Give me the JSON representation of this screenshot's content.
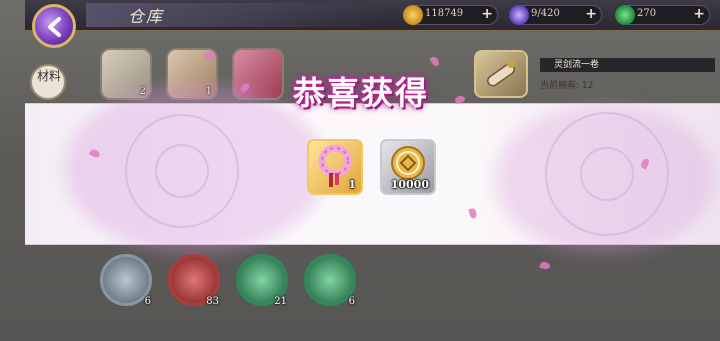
{
  "header": {
    "title": "仓库",
    "resources": [
      {
        "name": "gold",
        "icon": "gold-coin-icon",
        "value": "118749",
        "color": "#e0a83a"
      },
      {
        "name": "spirit",
        "icon": "purple-orb-icon",
        "value": "9/420",
        "color": "#7d5ad6"
      },
      {
        "name": "jade",
        "icon": "green-jade-icon",
        "value": "270",
        "color": "#37b24d"
      }
    ],
    "plus_label": "+"
  },
  "side_tabs": {
    "materials": "材料"
  },
  "inventory": {
    "top_row_counts": [
      "2",
      "1",
      "",
      ""
    ],
    "bottom_row": [
      {
        "icon": "wolf-blue-icon",
        "count": "6",
        "color": "#7d8fa0"
      },
      {
        "icon": "wolf-red-icon",
        "count": "83",
        "color": "#b13b3b"
      },
      {
        "icon": "wolf-green-icon",
        "count": "21",
        "color": "#2f8a5a"
      },
      {
        "icon": "wolf-green-icon",
        "count": "6",
        "color": "#2f8a5a"
      }
    ]
  },
  "detail": {
    "item_name": "灵剑流一卷",
    "owned_text": "当前拥有: 12"
  },
  "modal": {
    "title": "恭喜获得",
    "rewards": [
      {
        "icon": "pink-prayer-beads-icon",
        "count": "1",
        "frame": "gold"
      },
      {
        "icon": "silver-coin-icon",
        "count": "10000",
        "frame": "silver"
      }
    ]
  }
}
